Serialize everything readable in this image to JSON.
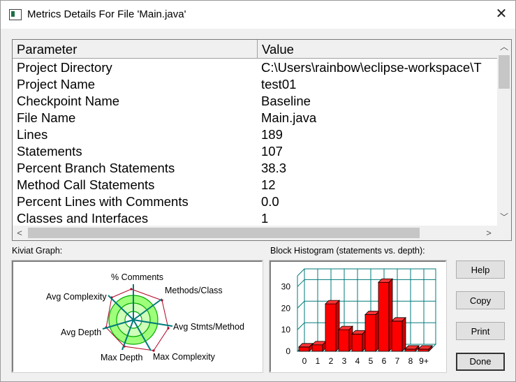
{
  "window": {
    "title": "Metrics Details For File 'Main.java'",
    "close_glyph": "✕"
  },
  "table": {
    "columns": [
      "Parameter",
      "Value"
    ],
    "rows": [
      [
        "Project Directory",
        "C:\\Users\\rainbow\\eclipse-workspace\\T"
      ],
      [
        "Project Name",
        "test01"
      ],
      [
        "Checkpoint Name",
        "Baseline"
      ],
      [
        "File Name",
        "Main.java"
      ],
      [
        "Lines",
        "189"
      ],
      [
        "Statements",
        "107"
      ],
      [
        "Percent Branch Statements",
        "38.3"
      ],
      [
        "Method Call Statements",
        "12"
      ],
      [
        "Percent Lines with Comments",
        "0.0"
      ],
      [
        "Classes and Interfaces",
        "1"
      ]
    ]
  },
  "kiviat": {
    "label": "Kiviat Graph:",
    "axes": [
      "% Comments",
      "Methods/Class",
      "Avg Stmts/Method",
      "Max Complexity",
      "Max Depth",
      "Avg Depth",
      "Avg Complexity"
    ]
  },
  "histogram": {
    "label": "Block Histogram (statements vs. depth):",
    "y_ticks": [
      "0",
      "10",
      "20",
      "30"
    ]
  },
  "buttons": {
    "help": "Help",
    "copy": "Copy",
    "print": "Print",
    "done": "Done"
  },
  "colors": {
    "bar": "#ff0000",
    "grid": "#008080",
    "kiviat_fill": "#9eff7a",
    "kiviat_ring": "#00aa00"
  },
  "chart_data": {
    "type": "bar",
    "title": "Block Histogram (statements vs. depth):",
    "categories": [
      "0",
      "1",
      "2",
      "3",
      "4",
      "5",
      "6",
      "7",
      "8",
      "9+"
    ],
    "values": [
      2,
      3,
      22,
      10,
      8,
      17,
      32,
      14,
      1,
      1
    ],
    "ylim": [
      0,
      35
    ],
    "grid": true
  }
}
